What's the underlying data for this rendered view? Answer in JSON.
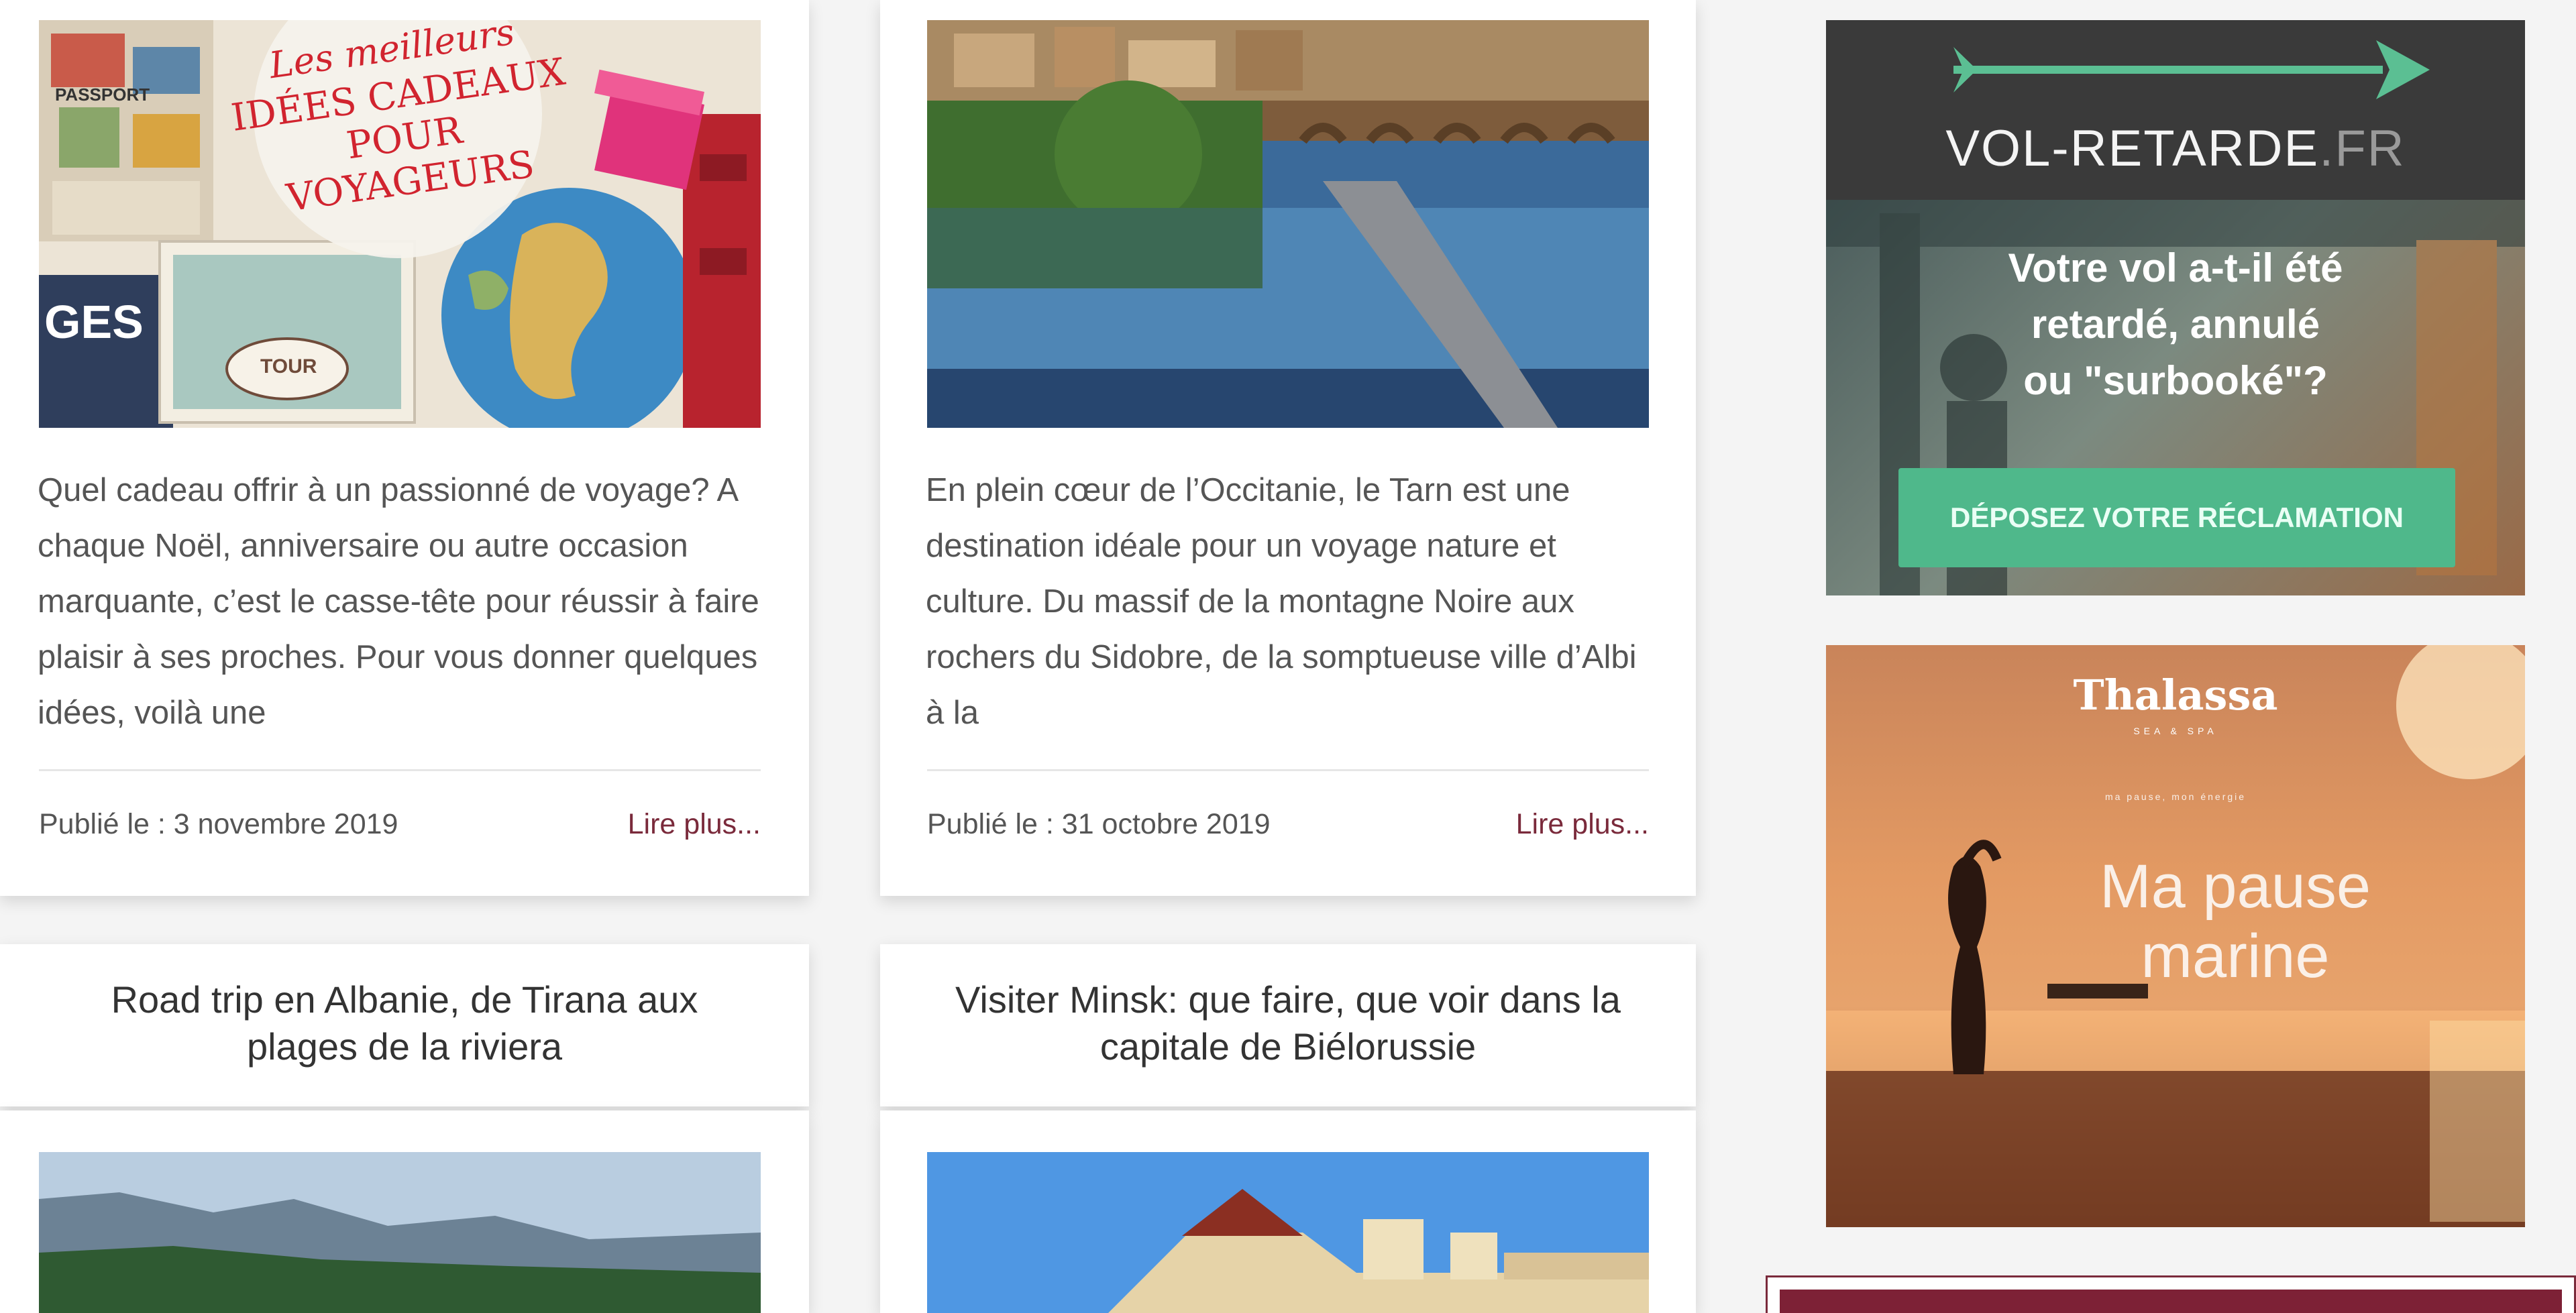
{
  "posts": [
    {
      "excerpt": "Quel cadeau offrir à un passionné de voyage? A chaque Noël, anniversaire ou autre occasion marquante, c’est le casse-tête pour réussir à faire plaisir à ses proches. Pour vous donner quelques idées, voilà une",
      "date": "Publié le : 3 novembre 2019",
      "more": "Lire plus...",
      "image_caption": [
        "Les meilleurs",
        "IDÉES CADEAUX",
        "POUR",
        "VOYAGEURS"
      ],
      "image_stamp": "PASSPORT",
      "image_tour": "TOUR",
      "image_ges": "GES"
    },
    {
      "excerpt": "En plein cœur de l’Occitanie, le Tarn est une destination idéale pour un voyage nature et culture. Du massif de la montagne Noire aux rochers du Sidobre, de la somptueuse ville d’Albi à la",
      "date": "Publié le : 31 octobre 2019",
      "more": "Lire plus..."
    },
    {
      "title": "Road trip en Albanie, de Tirana aux plages de la riviera"
    },
    {
      "title": "Visiter Minsk: que faire, que voir dans la capitale de Biélorussie"
    }
  ],
  "ads": {
    "vol": {
      "brand": "VOL-RETARDE",
      "tld": ".FR",
      "line1": "Votre vol a-t-il été",
      "line2": "retardé, annulé",
      "line3": "ou \"surbooké\"?",
      "cta": "DÉPOSEZ VOTRE RÉCLAMATION"
    },
    "thalassa": {
      "brand": "Thalassa",
      "sub": "SEA & SPA",
      "tagline": "ma pause, mon énergie",
      "headline1": "Ma pause",
      "headline2": "marine"
    }
  }
}
